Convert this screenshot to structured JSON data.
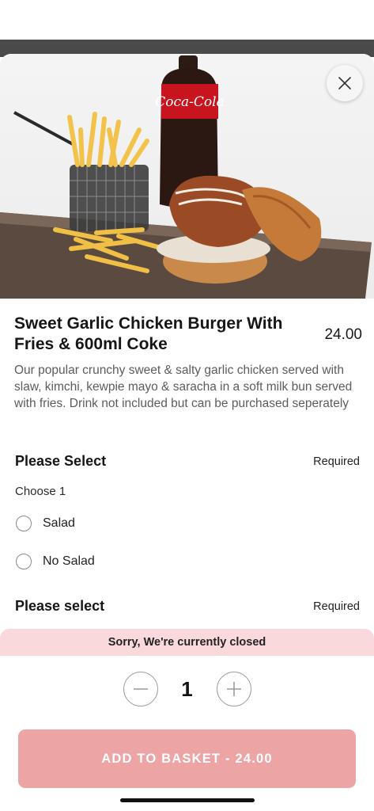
{
  "item": {
    "title": "Sweet Garlic Chicken Burger With Fries & 600ml Coke",
    "price": "24.00",
    "description": "Our popular crunchy sweet & salty garlic chicken served with slaw, kimchi, kewpie mayo & saracha in a soft milk bun served with fries. Drink not included but can be purchased seperately",
    "image_text": "Coca-Cola"
  },
  "sections": [
    {
      "title": "Please Select",
      "required": "Required",
      "hint": "Choose 1",
      "options": [
        {
          "label": "Salad",
          "selected": false
        },
        {
          "label": "No Salad",
          "selected": false
        }
      ]
    },
    {
      "title": "Please select",
      "required": "Required"
    }
  ],
  "banner": "Sorry, We're currently closed",
  "quantity": "1",
  "add_button": "ADD TO BASKET - 24.00",
  "icons": {
    "close": "close-icon",
    "minus": "minus-icon",
    "plus": "plus-icon"
  },
  "colors": {
    "add_button_bg": "#eca4a4",
    "banner_bg": "#f9d9dc"
  }
}
